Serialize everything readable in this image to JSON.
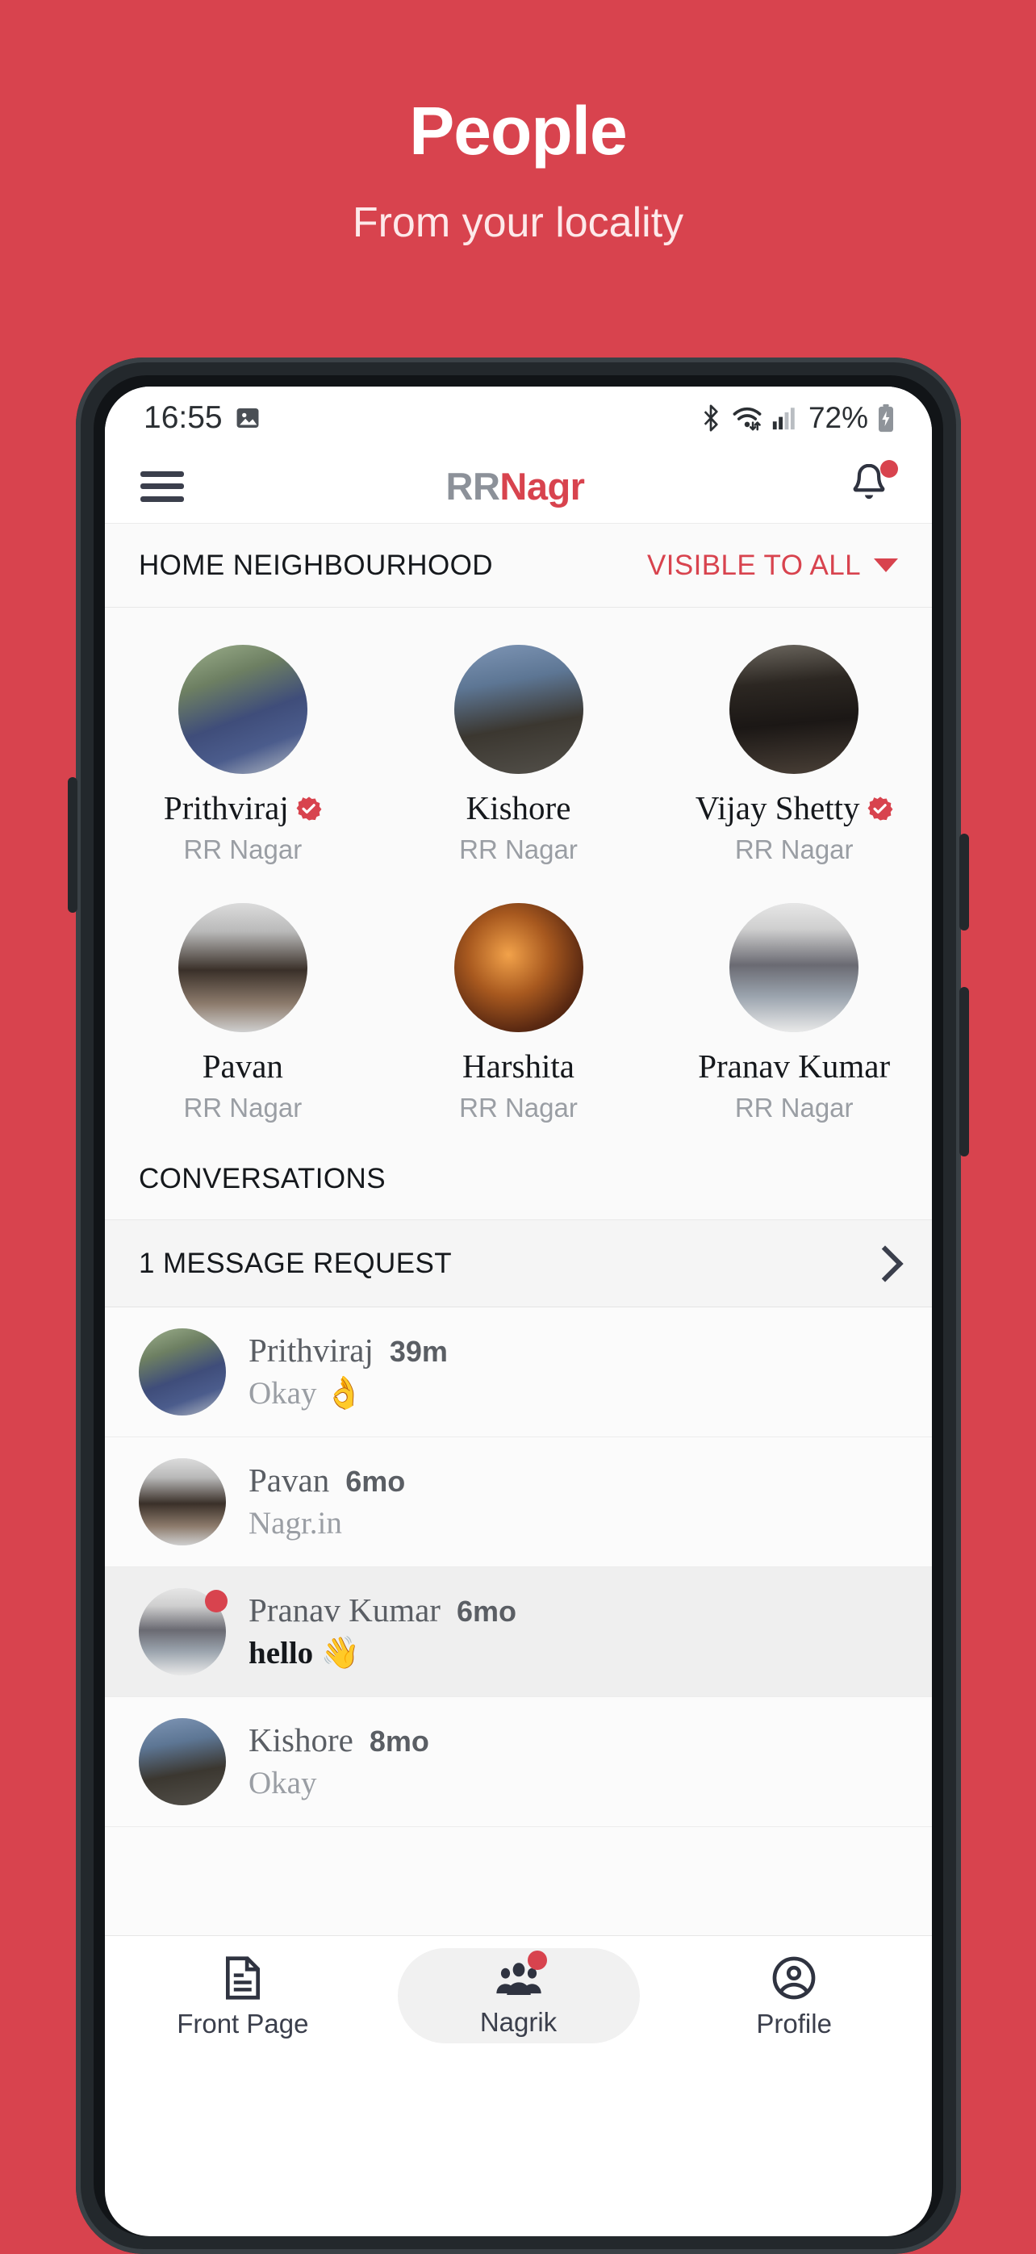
{
  "promo": {
    "title": "People",
    "subtitle": "From your locality",
    "background_color": "#d8434e"
  },
  "status_bar": {
    "time": "16:55",
    "battery_percent": "72%",
    "icons": [
      "image-icon",
      "bluetooth-icon",
      "wifi-icon",
      "cellular-signal-icon",
      "battery-charging-icon"
    ]
  },
  "app_bar": {
    "menu_icon": "hamburger-menu-icon",
    "brand_prefix": "RR",
    "brand_suffix": "Nagr",
    "notification_icon": "bell-icon",
    "has_notification_dot": true,
    "accent_color": "#d8434e"
  },
  "neighbourhood_bar": {
    "label": "HOME NEIGHBOURHOOD",
    "visibility_label": "VISIBLE TO ALL",
    "visibility_icon": "chevron-down-icon"
  },
  "people": {
    "rows": [
      [
        {
          "name": "Prithviraj",
          "locality": "RR Nagar",
          "verified": true
        },
        {
          "name": "Kishore",
          "locality": "RR Nagar",
          "verified": false
        },
        {
          "name": "Vijay Shetty",
          "locality": "RR Nagar",
          "verified": true
        }
      ],
      [
        {
          "name": "Pavan",
          "locality": "RR Nagar",
          "verified": false
        },
        {
          "name": "Harshita",
          "locality": "RR Nagar",
          "verified": false
        },
        {
          "name": "Pranav Kumar",
          "locality": "RR Nagar",
          "verified": false
        }
      ]
    ]
  },
  "conversations": {
    "heading": "CONVERSATIONS",
    "message_request": {
      "label": "1 MESSAGE REQUEST",
      "chevron_icon": "chevron-right-icon"
    },
    "threads": [
      {
        "name": "Prithviraj",
        "time": "39m",
        "preview": "Okay 👌",
        "unread": false,
        "dot": false
      },
      {
        "name": "Pavan",
        "time": "6mo",
        "preview": "Nagr.in",
        "unread": false,
        "dot": false
      },
      {
        "name": "Pranav Kumar",
        "time": "6mo",
        "preview": "hello 👋",
        "unread": true,
        "dot": true
      },
      {
        "name": "Kishore",
        "time": "8mo",
        "preview": "Okay",
        "unread": false,
        "dot": false
      }
    ]
  },
  "bottom_nav": {
    "items": [
      {
        "label": "Front Page",
        "icon": "document-icon",
        "active": false,
        "badge": false
      },
      {
        "label": "Nagrik",
        "icon": "people-group-icon",
        "active": true,
        "badge": true
      },
      {
        "label": "Profile",
        "icon": "user-circle-icon",
        "active": false,
        "badge": false
      }
    ]
  }
}
